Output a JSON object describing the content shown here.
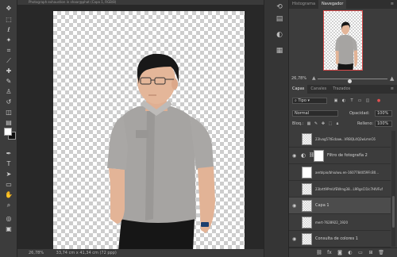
{
  "document": {
    "tab_title": "Photograph exhaustion in shaar@phat (Capa 1, RGB/8)",
    "status_zoom": "26,78%",
    "status_size": "33,74 cm x 41,34 cm (72 ppp)"
  },
  "panels": {
    "top_tabs": [
      "Histograma",
      "Navegador"
    ],
    "active_top_tab": "Navegador",
    "zoom_value": "26,78%",
    "zoom_level": 0.45,
    "layer_tabs": [
      "Capas",
      "Canales",
      "Trazados"
    ],
    "active_layer_tab": "Capas",
    "filter_kind": "Tipo",
    "blend_mode": "Normal",
    "opacity_label": "Opacidad:",
    "opacity_value": "100%",
    "lock_label": "Bloq.:",
    "fill_label": "Relleno:",
    "fill_value": "100%"
  },
  "layers": [
    {
      "name": "23lvog57tEcbaw...VRBQL4Q2wLmnC6",
      "type": "image",
      "visible": false,
      "selected": false
    },
    {
      "name": "Filtro de fotografía 2",
      "type": "adjustment",
      "visible": true,
      "selected": false
    },
    {
      "name": "aerblpio/bhiulwu.en-1607784059Fr.B0...",
      "type": "white",
      "visible": false,
      "selected": false
    },
    {
      "name": "23brtt9PmUfEWrng38...L9RgsCI1lc7HIVFuf",
      "type": "image",
      "visible": false,
      "selected": false
    },
    {
      "name": "Capa 1",
      "type": "image",
      "visible": true,
      "selected": true
    },
    {
      "name": "mert-7628922_1920",
      "type": "image",
      "visible": false,
      "selected": false
    },
    {
      "name": "Consulta de colores 1",
      "type": "adjustment",
      "visible": true,
      "selected": false
    }
  ],
  "colors": {
    "panel_bg": "#3c3c3c",
    "app_bg": "#282828",
    "navigator_frame": "#d94a4a",
    "selected_layer": "#4c4c4c"
  }
}
